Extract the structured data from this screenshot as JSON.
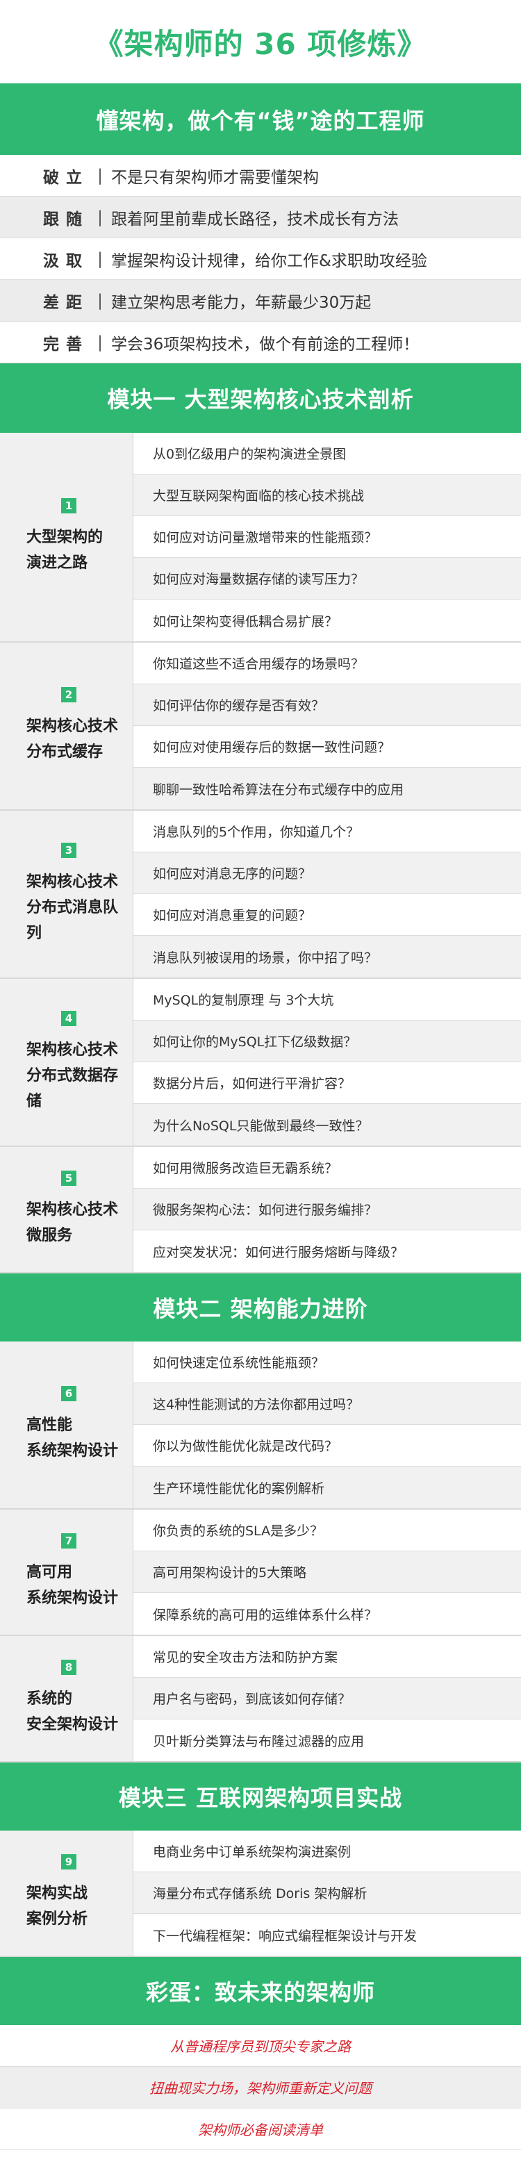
{
  "title": "《架构师的 36 项修炼》",
  "intro_banner": "懂架构，做个有“钱”途的工程师",
  "intro_rows": [
    {
      "key": "破立",
      "sep": "|",
      "text": "不是只有架构师才需要懂架构"
    },
    {
      "key": "跟随",
      "sep": "|",
      "text": "跟着阿里前辈成长路径，技术成长有方法"
    },
    {
      "key": "汲取",
      "sep": "|",
      "text": "掌握架构设计规律，给你工作&求职助攻经验"
    },
    {
      "key": "差距",
      "sep": "|",
      "text": "建立架构思考能力，年薪最少30万起"
    },
    {
      "key": "完善",
      "sep": "|",
      "text": "学会36项架构技术，做个有前途的工程师！"
    }
  ],
  "modules": [
    {
      "title": "模块一  大型架构核心技术剖析",
      "sections": [
        {
          "num": "1",
          "line1": "大型架构的",
          "line2": "演进之路",
          "items": [
            "从0到亿级用户的架构演进全景图",
            "大型互联网架构面临的核心技术挑战",
            "如何应对访问量激增带来的性能瓶颈？",
            "如何应对海量数据存储的读写压力？",
            "如何让架构变得低耦合易扩展？"
          ]
        },
        {
          "num": "2",
          "line1": "架构核心技术",
          "line2": "分布式缓存",
          "items": [
            "你知道这些不适合用缓存的场景吗？",
            "如何评估你的缓存是否有效？",
            "如何应对使用缓存后的数据一致性问题？",
            "聊聊一致性哈希算法在分布式缓存中的应用"
          ]
        },
        {
          "num": "3",
          "line1": "架构核心技术",
          "line2": "分布式消息队列",
          "items": [
            "消息队列的5个作用，你知道几个？",
            "如何应对消息无序的问题？",
            "如何应对消息重复的问题？",
            "消息队列被误用的场景，你中招了吗？"
          ]
        },
        {
          "num": "4",
          "line1": "架构核心技术",
          "line2": "分布式数据存储",
          "items": [
            "MySQL的复制原理 与 3个大坑",
            "如何让你的MySQL扛下亿级数据？",
            "数据分片后，如何进行平滑扩容？",
            "为什么NoSQL只能做到最终一致性？"
          ]
        },
        {
          "num": "5",
          "line1": "架构核心技术",
          "line2": "微服务",
          "items": [
            "如何用微服务改造巨无霸系统？",
            "微服务架构心法：如何进行服务编排？",
            "应对突发状况：如何进行服务熔断与降级？"
          ]
        }
      ]
    },
    {
      "title": "模块二  架构能力进阶",
      "sections": [
        {
          "num": "6",
          "line1": "高性能",
          "line2": "系统架构设计",
          "items": [
            "如何快速定位系统性能瓶颈？",
            "这4种性能测试的方法你都用过吗？",
            "你以为做性能优化就是改代码？",
            "生产环境性能优化的案例解析"
          ]
        },
        {
          "num": "7",
          "line1": "高可用",
          "line2": "系统架构设计",
          "items": [
            "你负责的系统的SLA是多少？",
            "高可用架构设计的5大策略",
            "保障系统的高可用的运维体系什么样？"
          ]
        },
        {
          "num": "8",
          "line1": "系统的",
          "line2": "安全架构设计",
          "items": [
            "常见的安全攻击方法和防护方案",
            "用户名与密码，到底该如何存储？",
            "贝叶斯分类算法与布隆过滤器的应用"
          ]
        }
      ]
    },
    {
      "title": "模块三  互联网架构项目实战",
      "sections": [
        {
          "num": "9",
          "line1": "架构实战",
          "line2": "案例分析",
          "items": [
            "电商业务中订单系统架构演进案例",
            "海量分布式存储系统 Doris 架构解析",
            "下一代编程框架：响应式编程框架设计与开发"
          ]
        }
      ]
    }
  ],
  "bonus": {
    "title": "彩蛋：致未来的架构师",
    "items": [
      "从普通程序员到顶尖专家之路",
      "扭曲现实力场，架构师重新定义问题",
      "架构师必备阅读清单"
    ]
  },
  "colors": {
    "accent": "#2fb872",
    "bonus_text": "#d9232d"
  }
}
